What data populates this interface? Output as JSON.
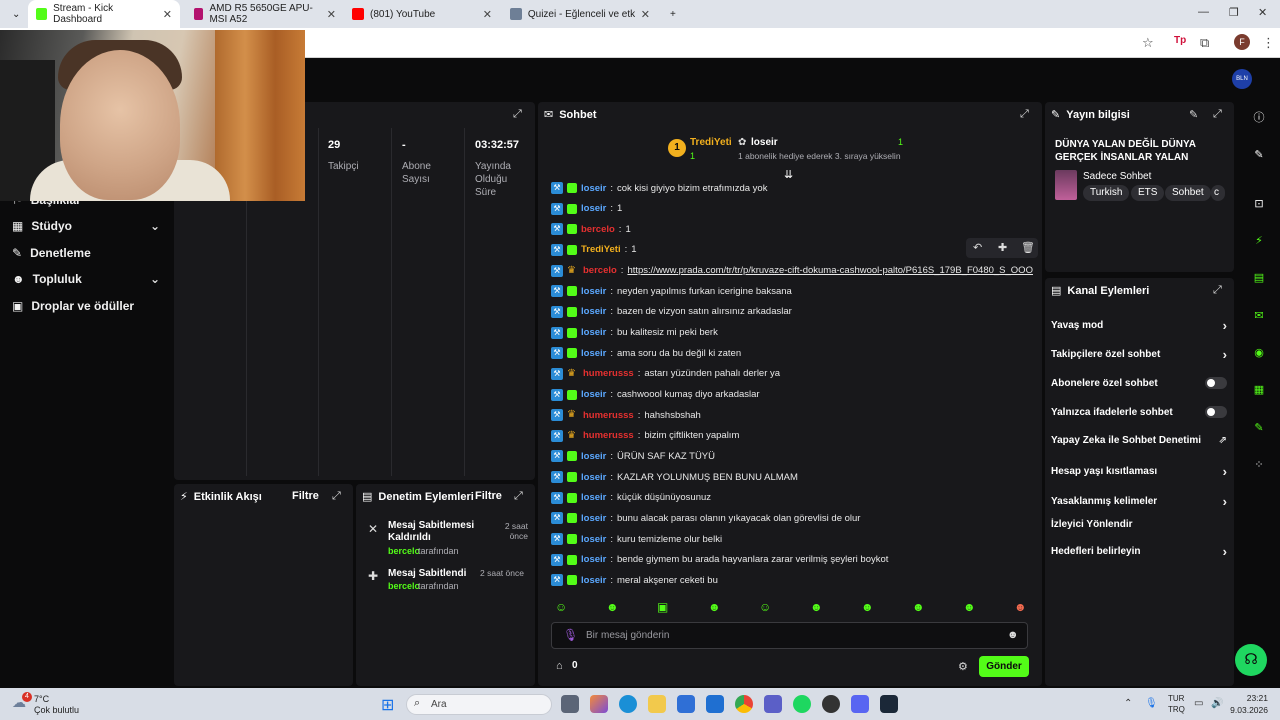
{
  "browser": {
    "tabs": [
      {
        "title": "Stream - Kick Dashboard",
        "color": "#53fc18",
        "active": true
      },
      {
        "title": "AMD R5 5650GE APU-MSI A52",
        "color": "#b3126e",
        "active": false
      },
      {
        "title": "(801) YouTube",
        "color": "#ff0000",
        "active": false
      },
      {
        "title": "Quizei - Eğlenceli ve etkileşimi",
        "color": "#6e7f96",
        "active": false
      }
    ],
    "profile_letter": "F"
  },
  "header": {
    "user_badge": "BLN"
  },
  "sidebar": {
    "items": [
      {
        "label": "Başlıklar",
        "icon": "flag-icon",
        "has_chevron": false
      },
      {
        "label": "Stüdyo",
        "icon": "studio-icon",
        "has_chevron": true
      },
      {
        "label": "Denetleme",
        "icon": "wrench-icon",
        "has_chevron": false
      },
      {
        "label": "Topluluk",
        "icon": "people-icon",
        "has_chevron": true
      },
      {
        "label": "Droplar ve ödüller",
        "icon": "gift-icon",
        "has_chevron": false
      }
    ]
  },
  "stats": [
    {
      "value": "29",
      "label": "Takipçi"
    },
    {
      "value": "-",
      "label": "Abone Sayısı"
    },
    {
      "value": "03:32:57",
      "label": "Yayında Olduğu Süre"
    }
  ],
  "activity": {
    "title": "Etkinlik Akışı",
    "filter": "Filtre"
  },
  "moderation": {
    "title": "Denetim Eylemleri",
    "filter": "Filtre",
    "items": [
      {
        "action": "Mesaj Sabitlemesi Kaldırıldı",
        "user": "bercelo",
        "suffix": "tarafından",
        "time": "2 saat önce"
      },
      {
        "action": "Mesaj Sabitlendi",
        "user": "bercelo",
        "suffix": "tarafından",
        "time": "2 saat önce"
      }
    ]
  },
  "chat": {
    "title": "Sohbet",
    "pinned": {
      "rank": "1",
      "user": "TrediYeti",
      "user_count": "1",
      "gifter": "loseir",
      "gifter_count": "1",
      "message": "1 abonelik hediye ederek 3. sıraya yükselin"
    },
    "messages": [
      {
        "user": "loseir",
        "color": "#5ba8ff",
        "badge": "sub",
        "text": "cok kisi giyiyo bizim etrafımızda yok"
      },
      {
        "user": "loseir",
        "color": "#5ba8ff",
        "badge": "sub",
        "text": "1"
      },
      {
        "user": "bercelo",
        "color": "#e53030",
        "badge": "sub",
        "text": "1"
      },
      {
        "user": "TrediYeti",
        "color": "#f2b01e",
        "badge": "sub",
        "text": "1"
      },
      {
        "user": "bercelo",
        "color": "#e53030",
        "badge": "crown",
        "text": "https://www.prada.com/tr/tr/p/kruvaze-cift-dokuma-cashwool-palto/P616S_179B_F0480_S_OOO",
        "link": true
      },
      {
        "user": "loseir",
        "color": "#5ba8ff",
        "badge": "sub",
        "text": "neyden yapılmıs furkan icerigine baksana"
      },
      {
        "user": "loseir",
        "color": "#5ba8ff",
        "badge": "sub",
        "text": "bazen de vizyon satın alırsınız arkadaslar"
      },
      {
        "user": "loseir",
        "color": "#5ba8ff",
        "badge": "sub",
        "text": "bu kalitesiz mi peki berk"
      },
      {
        "user": "loseir",
        "color": "#5ba8ff",
        "badge": "sub",
        "text": "ama soru da bu değil ki zaten"
      },
      {
        "user": "humerusss",
        "color": "#e53030",
        "badge": "crown",
        "text": "astarı yüzünden pahalı derler ya"
      },
      {
        "user": "loseir",
        "color": "#5ba8ff",
        "badge": "sub",
        "text": "cashwoool kumaş diyo arkadaslar"
      },
      {
        "user": "humerusss",
        "color": "#e53030",
        "badge": "crown",
        "text": "hahshsbshah"
      },
      {
        "user": "humerusss",
        "color": "#e53030",
        "badge": "crown",
        "text": "bizim çiftlikten yapalım"
      },
      {
        "user": "loseir",
        "color": "#5ba8ff",
        "badge": "sub",
        "text": "ÜRÜN SAF KAZ TÜYÜ"
      },
      {
        "user": "loseir",
        "color": "#5ba8ff",
        "badge": "sub",
        "text": "KAZLAR YOLUNMUŞ BEN BUNU ALMAM"
      },
      {
        "user": "loseir",
        "color": "#5ba8ff",
        "badge": "sub",
        "text": "küçük düşünüyosunuz"
      },
      {
        "user": "loseir",
        "color": "#5ba8ff",
        "badge": "sub",
        "text": "bunu alacak parası olanın yıkayacak olan görevlisi de olur"
      },
      {
        "user": "loseir",
        "color": "#5ba8ff",
        "badge": "sub",
        "text": "kuru temizleme olur belki"
      },
      {
        "user": "loseir",
        "color": "#5ba8ff",
        "badge": "sub",
        "text": "bende giymem bu arada hayvanlara zarar verilmiş şeyleri boykot"
      },
      {
        "user": "loseir",
        "color": "#5ba8ff",
        "badge": "sub",
        "text": "meral akşener ceketi bu"
      }
    ],
    "input_placeholder": "Bir mesaj gönderin",
    "points": "0",
    "send_label": "Gönder"
  },
  "stream_info": {
    "title_label": "Yayın bilgisi",
    "stream_title": "DÜNYA YALAN DEĞİL DÜNYA GERÇEK İNSANLAR YALAN",
    "category": "Sadece Sohbet",
    "tags": [
      "Turkish",
      "ETS",
      "Sohbet",
      "c"
    ]
  },
  "channel_actions": {
    "title": "Kanal Eylemleri",
    "items": [
      {
        "label": "Yavaş mod",
        "control": "chevron"
      },
      {
        "label": "Takipçilere özel sohbet",
        "control": "chevron"
      },
      {
        "label": "Abonelere özel sohbet",
        "control": "toggle"
      },
      {
        "label": "Yalnızca ifadelerle sohbet",
        "control": "toggle"
      },
      {
        "label": "Yapay Zeka ile Sohbet Denetimi",
        "control": "external"
      },
      {
        "label": "Hesap yaşı kısıtlaması",
        "control": "chevron"
      },
      {
        "label": "Yasaklanmış kelimeler",
        "control": "chevron"
      },
      {
        "label": "İzleyici Yönlendir",
        "control": "none"
      },
      {
        "label": "Hedefleri belirleyin",
        "control": "chevron"
      }
    ]
  },
  "taskbar": {
    "weather_temp": "7°C",
    "weather_text": "Çok bulutlu",
    "weather_alert": "4",
    "search_placeholder": "Ara",
    "lang_top": "TUR",
    "lang_bottom": "TRQ",
    "time": "23:21",
    "date": "9.03.2026"
  }
}
